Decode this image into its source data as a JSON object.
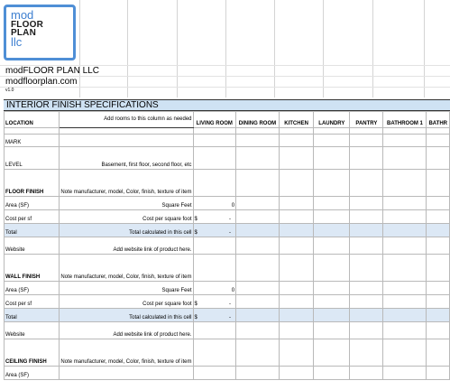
{
  "logo": {
    "line1": "mod",
    "line2": "FLOOR",
    "line3": "PLAN",
    "line4": "llc"
  },
  "company_name": "modFLOOR PLAN LLC",
  "website": "modfloorplan.com",
  "version": "v1.0",
  "sheet_title": "INTERIOR FINISH SPECIFICATIONS",
  "columns": {
    "location": "LOCATION",
    "note": "Add rooms to this column as needed",
    "rooms": [
      "LIVING ROOM",
      "DINING ROOM",
      "KITCHEN",
      "LAUNDRY",
      "PANTRY",
      "BATHROOM 1",
      "BATHR"
    ]
  },
  "rows": {
    "mark": "MARK",
    "level": "LEVEL",
    "level_desc": "Basement, first floor, second floor, etc",
    "floor_finish": "FLOOR FINISH",
    "wall_finish": "WALL FINISH",
    "ceiling_finish": "CEILING FINISH",
    "finish_desc": "Note manufacturer, model, Color, finish, texture of item",
    "area": "Area (SF)",
    "area_desc": "Square Feet",
    "area_value": "0",
    "cost": "Cost per sf",
    "cost_desc": "Cost per square foot",
    "dollar": "$",
    "dash": "-",
    "total": "Total",
    "total_desc": "Total calculated in this cell",
    "website_row": "Website",
    "website_desc": "Add website link of product here.",
    "area_partial": "Area (SF)"
  }
}
